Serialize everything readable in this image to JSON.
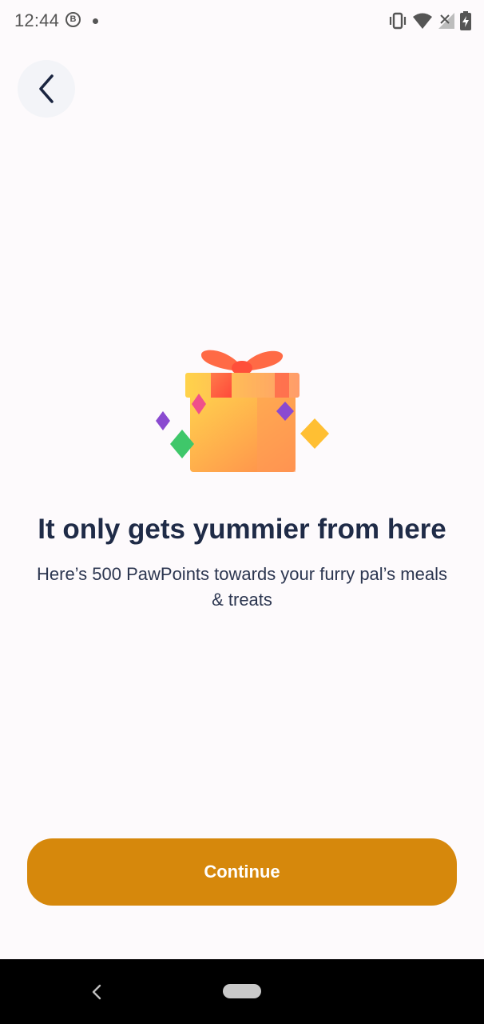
{
  "status_bar": {
    "time": "12:44",
    "badge_letter": "B",
    "icons": [
      "vibrate-icon",
      "wifi-icon",
      "signal-off-icon",
      "battery-charging-icon"
    ]
  },
  "header": {
    "back_icon": "chevron-left-icon"
  },
  "reward": {
    "illustration": "gift-box-icon",
    "headline": "It only gets yummier from here",
    "description": "Here’s 500 PawPoints towards your furry pal’s meals & treats"
  },
  "actions": {
    "continue_label": "Continue"
  },
  "nav_bar": {
    "back_icon": "nav-back-icon",
    "home_icon": "nav-home-pill"
  },
  "colors": {
    "background": "#fdfafc",
    "button": "#d6880c",
    "headline": "#1f2b47",
    "nav": "#000000"
  }
}
